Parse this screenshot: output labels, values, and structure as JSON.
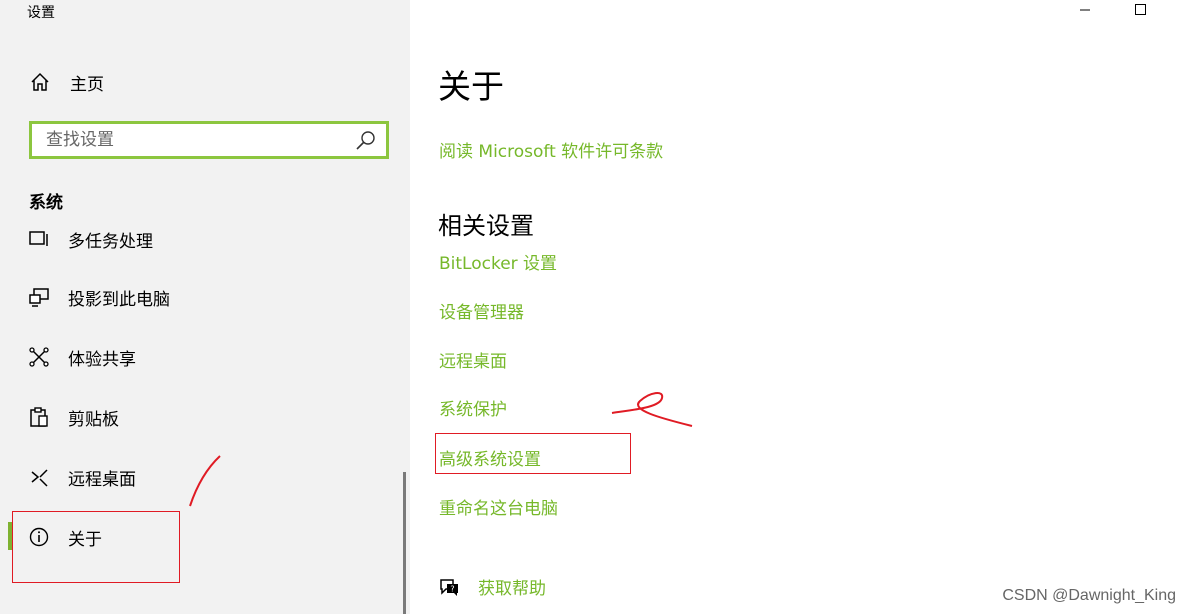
{
  "window": {
    "title": "设置",
    "minimize_icon": "minimize-icon",
    "maximize_icon": "maximize-icon"
  },
  "sidebar": {
    "home_label": "主页",
    "search_placeholder": "查找设置",
    "search_value": "",
    "section_title": "系统",
    "items": [
      {
        "label": "多任务处理",
        "icon": "multitasking-icon"
      },
      {
        "label": "投影到此电脑",
        "icon": "projection-icon"
      },
      {
        "label": "体验共享",
        "icon": "shared-experience-icon"
      },
      {
        "label": "剪贴板",
        "icon": "clipboard-icon"
      },
      {
        "label": "远程桌面",
        "icon": "remote-desktop-icon"
      },
      {
        "label": "关于",
        "icon": "info-icon",
        "active": true
      }
    ]
  },
  "main": {
    "title": "关于",
    "license_link": "阅读 Microsoft 软件许可条款",
    "related_title": "相关设置",
    "related_links": [
      "BitLocker 设置",
      "设备管理器",
      "远程桌面",
      "系统保护",
      "高级系统设置",
      "重命名这台电脑"
    ],
    "help_label": "获取帮助"
  },
  "watermark": "CSDN @Dawnight_King",
  "colors": {
    "accent": "#76b82a",
    "search_border": "#8cc63f",
    "sidebar_bg": "#f2f2f2",
    "annotation": "#e01b24"
  }
}
